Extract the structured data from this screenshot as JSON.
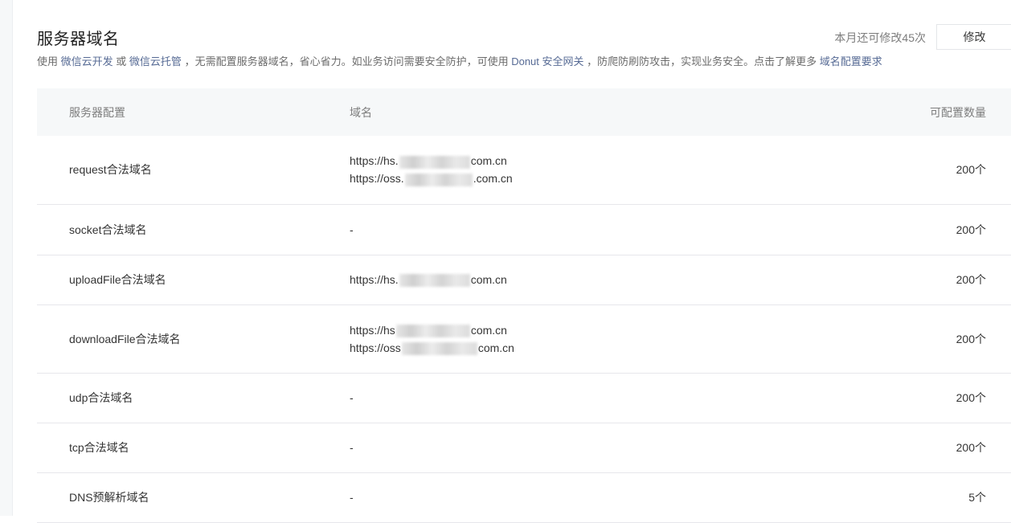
{
  "header": {
    "title": "服务器域名",
    "quota_text": "本月还可修改45次",
    "edit_label": "修改"
  },
  "description": {
    "part1": "使用",
    "link1": "微信云开发",
    "part2": "或",
    "link2": "微信云托管",
    "part3": "，无需配置服务器域名，省心省力。如业务访问需要安全防护，可使用",
    "link3": "Donut 安全网关",
    "part4": "，防爬防刷防攻击，实现业务安全。点击了解更多",
    "link4": "域名配置要求"
  },
  "table": {
    "headers": {
      "config": "服务器配置",
      "domain": "域名",
      "count": "可配置数量"
    },
    "rows": [
      {
        "name": "request合法域名",
        "domains": [
          {
            "prefix": "https://hs.",
            "suffix": "com.cn"
          },
          {
            "prefix": "https://oss.",
            "suffix": ".com.cn"
          }
        ],
        "count": "200个"
      },
      {
        "name": "socket合法域名",
        "dash": "-",
        "count": "200个"
      },
      {
        "name": "uploadFile合法域名",
        "domains": [
          {
            "prefix": "https://hs.",
            "suffix": "com.cn"
          }
        ],
        "count": "200个"
      },
      {
        "name": "downloadFile合法域名",
        "domains": [
          {
            "prefix": "https://hs",
            "suffix": "com.cn"
          },
          {
            "prefix": "https://oss",
            "suffix": "com.cn"
          }
        ],
        "count": "200个"
      },
      {
        "name": "udp合法域名",
        "dash": "-",
        "count": "200个"
      },
      {
        "name": "tcp合法域名",
        "dash": "-",
        "count": "200个"
      },
      {
        "name": "DNS预解析域名",
        "dash": "-",
        "count": "5个"
      }
    ]
  }
}
